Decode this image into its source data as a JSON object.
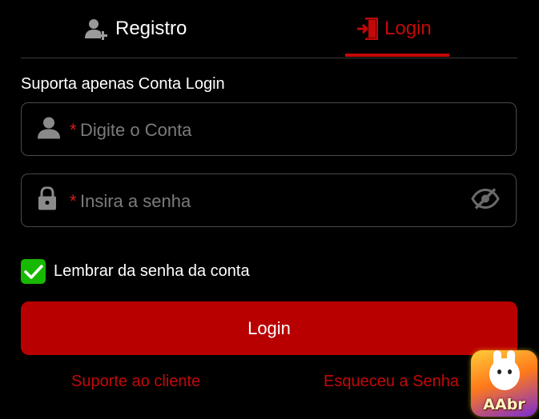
{
  "tabs": {
    "register_label": "Registro",
    "login_label": "Login",
    "active": "Login",
    "active_color": "#c40808"
  },
  "subtitle": "Suporta apenas Conta Login",
  "account_field": {
    "required_mark": "*",
    "placeholder": "Digite o Conta",
    "value": "",
    "icon": "user-icon"
  },
  "password_field": {
    "required_mark": "*",
    "placeholder": "Insira a senha",
    "value": "",
    "icon": "lock-icon",
    "toggle_icon": "eye-off-icon"
  },
  "remember": {
    "label": "Lembrar da senha da conta",
    "checked": true,
    "checkbox_color": "#17b800"
  },
  "login_button": {
    "label": "Login",
    "color": "#b90000"
  },
  "links": {
    "support": "Suporte ao cliente",
    "forgot": "Esqueceu a Senha"
  },
  "floating_badge": {
    "text": "AAbr",
    "icon": "rabbit-mascot-icon"
  }
}
